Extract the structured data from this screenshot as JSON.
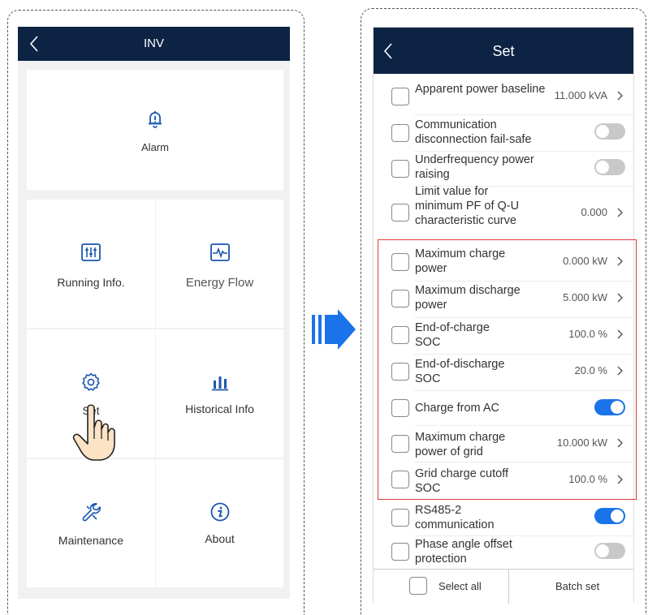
{
  "left": {
    "header_title": "INV",
    "alarm_label": "Alarm",
    "running_label": "Running Info.",
    "energy_label": "Energy Flow",
    "set_label": "Set",
    "historical_label": "Historical Info",
    "maintenance_label": "Maintenance",
    "about_label": "About"
  },
  "right": {
    "header_title": "Set",
    "rows": [
      {
        "name": "Apparent power baseline",
        "value": "11.000 kVA",
        "type": "value"
      },
      {
        "name": "Communication disconnection fail-safe",
        "type": "toggle",
        "on": false
      },
      {
        "name": "Underfrequency power raising",
        "type": "toggle",
        "on": false
      },
      {
        "name": "Limit value for minimum PF of Q-U characteristic curve",
        "value": "0.000",
        "type": "value"
      },
      {
        "name": "Maximum charge power",
        "value": "0.000 kW",
        "type": "value"
      },
      {
        "name": "Maximum discharge power",
        "value": "5.000 kW",
        "type": "value"
      },
      {
        "name": "End-of-charge SOC",
        "value": "100.0 %",
        "type": "value"
      },
      {
        "name": "End-of-discharge SOC",
        "value": "20.0 %",
        "type": "value"
      },
      {
        "name": "Charge from AC",
        "type": "toggle",
        "on": true
      },
      {
        "name": "Maximum charge power of grid",
        "value": "10.000 kW",
        "type": "value"
      },
      {
        "name": "Grid charge cutoff SOC",
        "value": "100.0 %",
        "type": "value"
      },
      {
        "name": "RS485-2 communication",
        "type": "toggle",
        "on": true
      },
      {
        "name": "Phase angle offset protection",
        "type": "toggle",
        "on": false
      }
    ],
    "select_all_label": "Select all",
    "batch_set_label": "Batch set"
  },
  "colors": {
    "header_bg": "#0d2344",
    "accent_blue": "#1a73e8",
    "highlight_red": "#e03a3a",
    "toggle_off": "#c8c8c8"
  }
}
